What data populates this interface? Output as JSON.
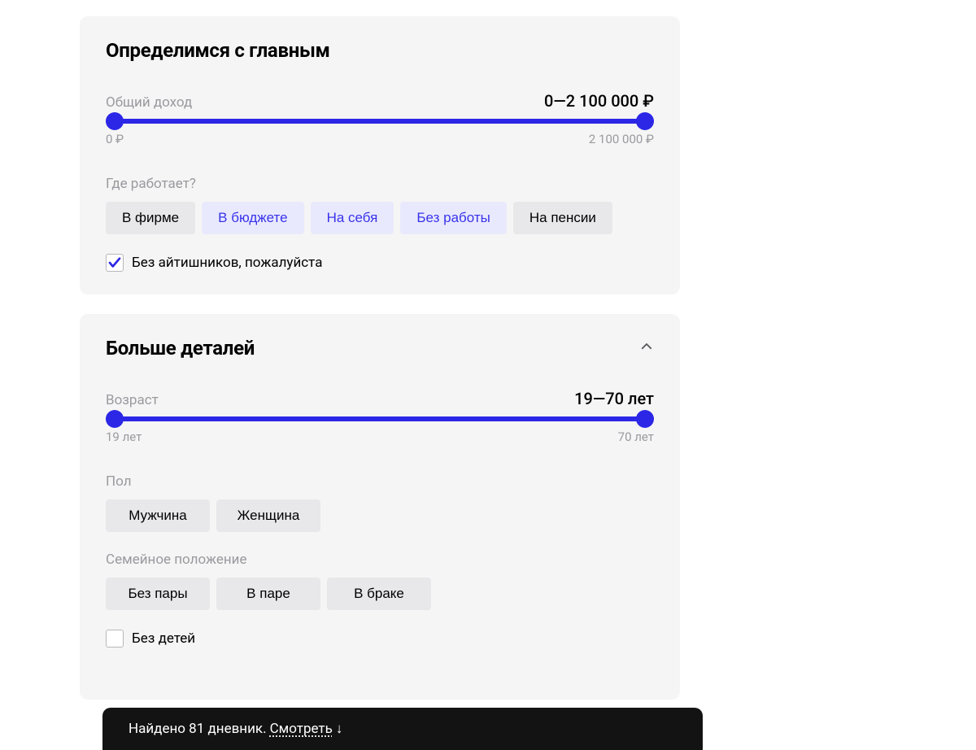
{
  "main": {
    "title": "Определимся с главным",
    "income": {
      "label": "Общий доход",
      "valueText": "0—2 100 000 ₽",
      "minLabel": "0 ₽",
      "maxLabel": "2 100 000 ₽"
    },
    "work": {
      "question": "Где работает?",
      "options": [
        {
          "label": "В фирме",
          "selected": false
        },
        {
          "label": "В бюджете",
          "selected": true
        },
        {
          "label": "На себя",
          "selected": true
        },
        {
          "label": "Без работы",
          "selected": true
        },
        {
          "label": "На пенсии",
          "selected": false
        }
      ]
    },
    "noIt": {
      "label": "Без айтишников, пожалуйста",
      "checked": true
    }
  },
  "details": {
    "title": "Больше деталей",
    "age": {
      "label": "Возраст",
      "valueText": "19—70 лет",
      "minLabel": "19 лет",
      "maxLabel": "70 лет"
    },
    "gender": {
      "label": "Пол",
      "options": [
        {
          "label": "Мужчина",
          "selected": false
        },
        {
          "label": "Женщина",
          "selected": false
        }
      ]
    },
    "maritalStatus": {
      "label": "Семейное положение",
      "options": [
        {
          "label": "Без пары",
          "selected": false
        },
        {
          "label": "В паре",
          "selected": false
        },
        {
          "label": "В браке",
          "selected": false
        }
      ]
    },
    "noKids": {
      "label": "Без детей",
      "checked": false
    }
  },
  "footer": {
    "text": "Найдено 81 дневник.",
    "link": "Смотреть",
    "arrow": "↓"
  }
}
